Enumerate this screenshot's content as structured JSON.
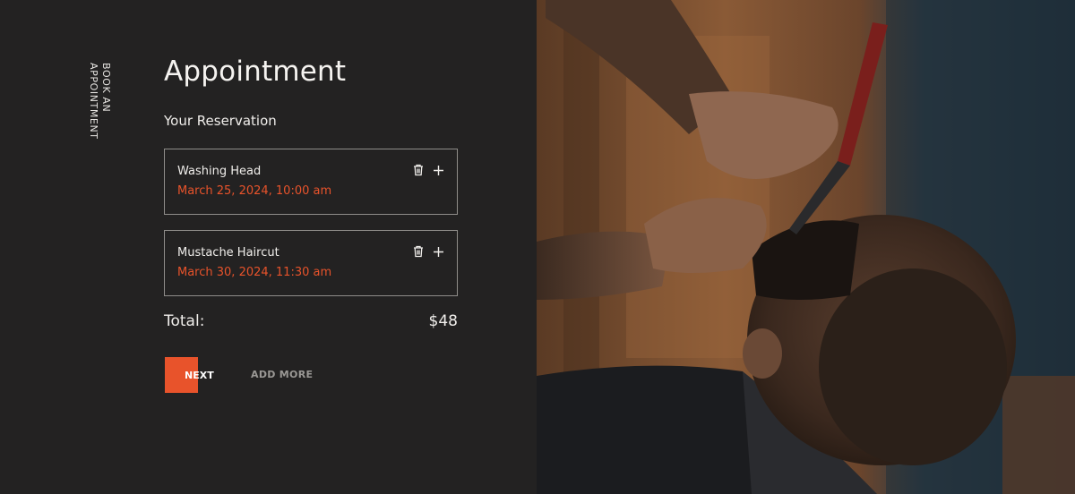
{
  "sidebar": {
    "vertical_label": "BOOK AN\nAPPOINTMENT"
  },
  "header": {
    "title": "Appointment",
    "subtitle": "Your Reservation"
  },
  "reservations": [
    {
      "service": "Washing Head",
      "datetime": "March 25, 2024, 10:00 am"
    },
    {
      "service": "Mustache Haircut",
      "datetime": "March 30, 2024, 11:30 am"
    }
  ],
  "summary": {
    "total_label": "Total:",
    "total_value": "$48"
  },
  "actions": {
    "next_label": "NEXT",
    "add_more_label": "ADD MORE"
  },
  "icons": {
    "delete": "trash-icon",
    "add": "plus-icon"
  },
  "colors": {
    "accent": "#e8532b",
    "background": "#232222",
    "text": "#f0eeeb",
    "muted": "#9a9895",
    "border": "#8f8d8a"
  },
  "hero_image": {
    "subject": "barber-shaving-beard-photo"
  }
}
